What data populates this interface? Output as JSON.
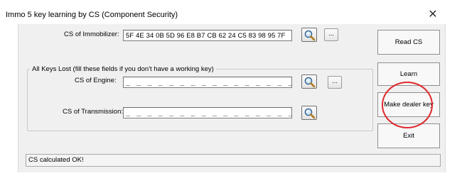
{
  "window": {
    "title": "Immo 5 key learning by CS (Component Security)",
    "close_glyph": "✕"
  },
  "immobilizer": {
    "label": "CS of Immobilizer:",
    "value": "5F 4E 34 0B 5D 96 E8 B7 CB 62 24 C5 83 98 95 7F",
    "search_icon": "magnifier-icon",
    "browse_label": "..."
  },
  "all_keys_lost": {
    "group_label": "All Keys Lost (fill these fields if you don't have a working key)",
    "engine": {
      "label": "CS of Engine:",
      "value": "_ _ _ _ _ _ _ _ _ _ _ _ _ _ _ _",
      "search_icon": "magnifier-icon",
      "browse_label": "..."
    },
    "transmission": {
      "label": "CS of Transmission:",
      "value": "_ _ _ _ _ _ _ _ _ _ _ _ _ _ _ _",
      "search_icon": "magnifier-icon"
    }
  },
  "buttons": {
    "read_cs": "Read CS",
    "learn": "Learn",
    "make_dealer_key": "Make dealer key",
    "exit": "Exit"
  },
  "status": {
    "text": "CS calculated OK!"
  },
  "annotation": {
    "highlight_color": "#e0282d"
  }
}
